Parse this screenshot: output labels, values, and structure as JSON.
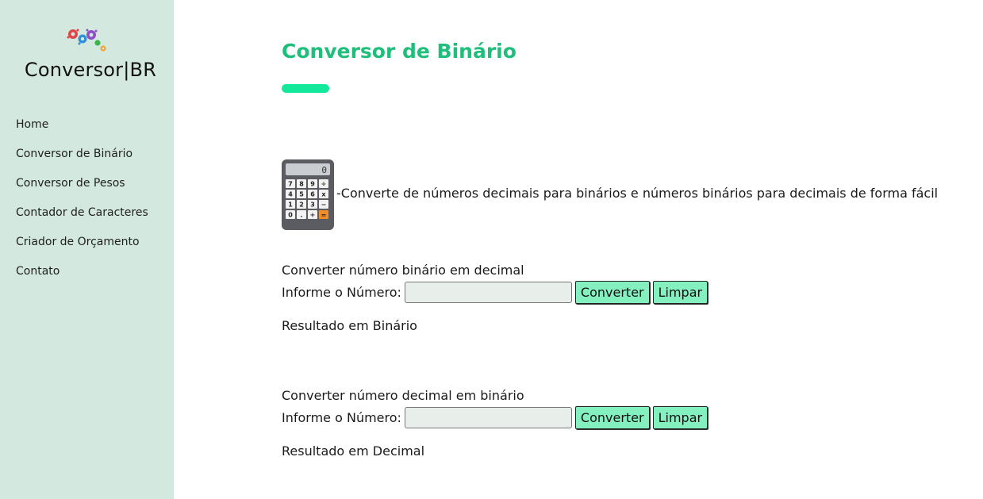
{
  "brand": {
    "name": "Conversor|BR",
    "logo_icon": "gears-icon"
  },
  "sidebar": {
    "items": [
      {
        "label": "Home"
      },
      {
        "label": "Conversor de Binário"
      },
      {
        "label": "Conversor de Pesos"
      },
      {
        "label": "Contador de Caracteres"
      },
      {
        "label": "Criador de Orçamento"
      },
      {
        "label": "Contato"
      }
    ]
  },
  "main": {
    "title": "Conversor de Binário",
    "accent_color": "#1fbf7b",
    "bar_color": "#14e89a",
    "icon": "calculator-icon",
    "calculator_keys": [
      "7",
      "8",
      "9",
      "÷",
      "4",
      "5",
      "6",
      "x",
      "1",
      "2",
      "3",
      "−",
      "0",
      ".",
      "+",
      "="
    ],
    "calculator_display": "0",
    "description": "-Converte de números decimais para binários e números binários para decimais de forma fácil",
    "binary_to_decimal": {
      "heading": "Converter número binário em decimal",
      "input_label": "Informe o Número:",
      "input_value": "",
      "convert_label": "Converter",
      "clear_label": "Limpar",
      "result_text": "Resultado em Binário"
    },
    "decimal_to_binary": {
      "heading": "Converter número decimal em binário",
      "input_label": "Informe o Número:",
      "input_value": "",
      "convert_label": "Converter",
      "clear_label": "Limpar",
      "result_text": "Resultado em Decimal"
    }
  }
}
